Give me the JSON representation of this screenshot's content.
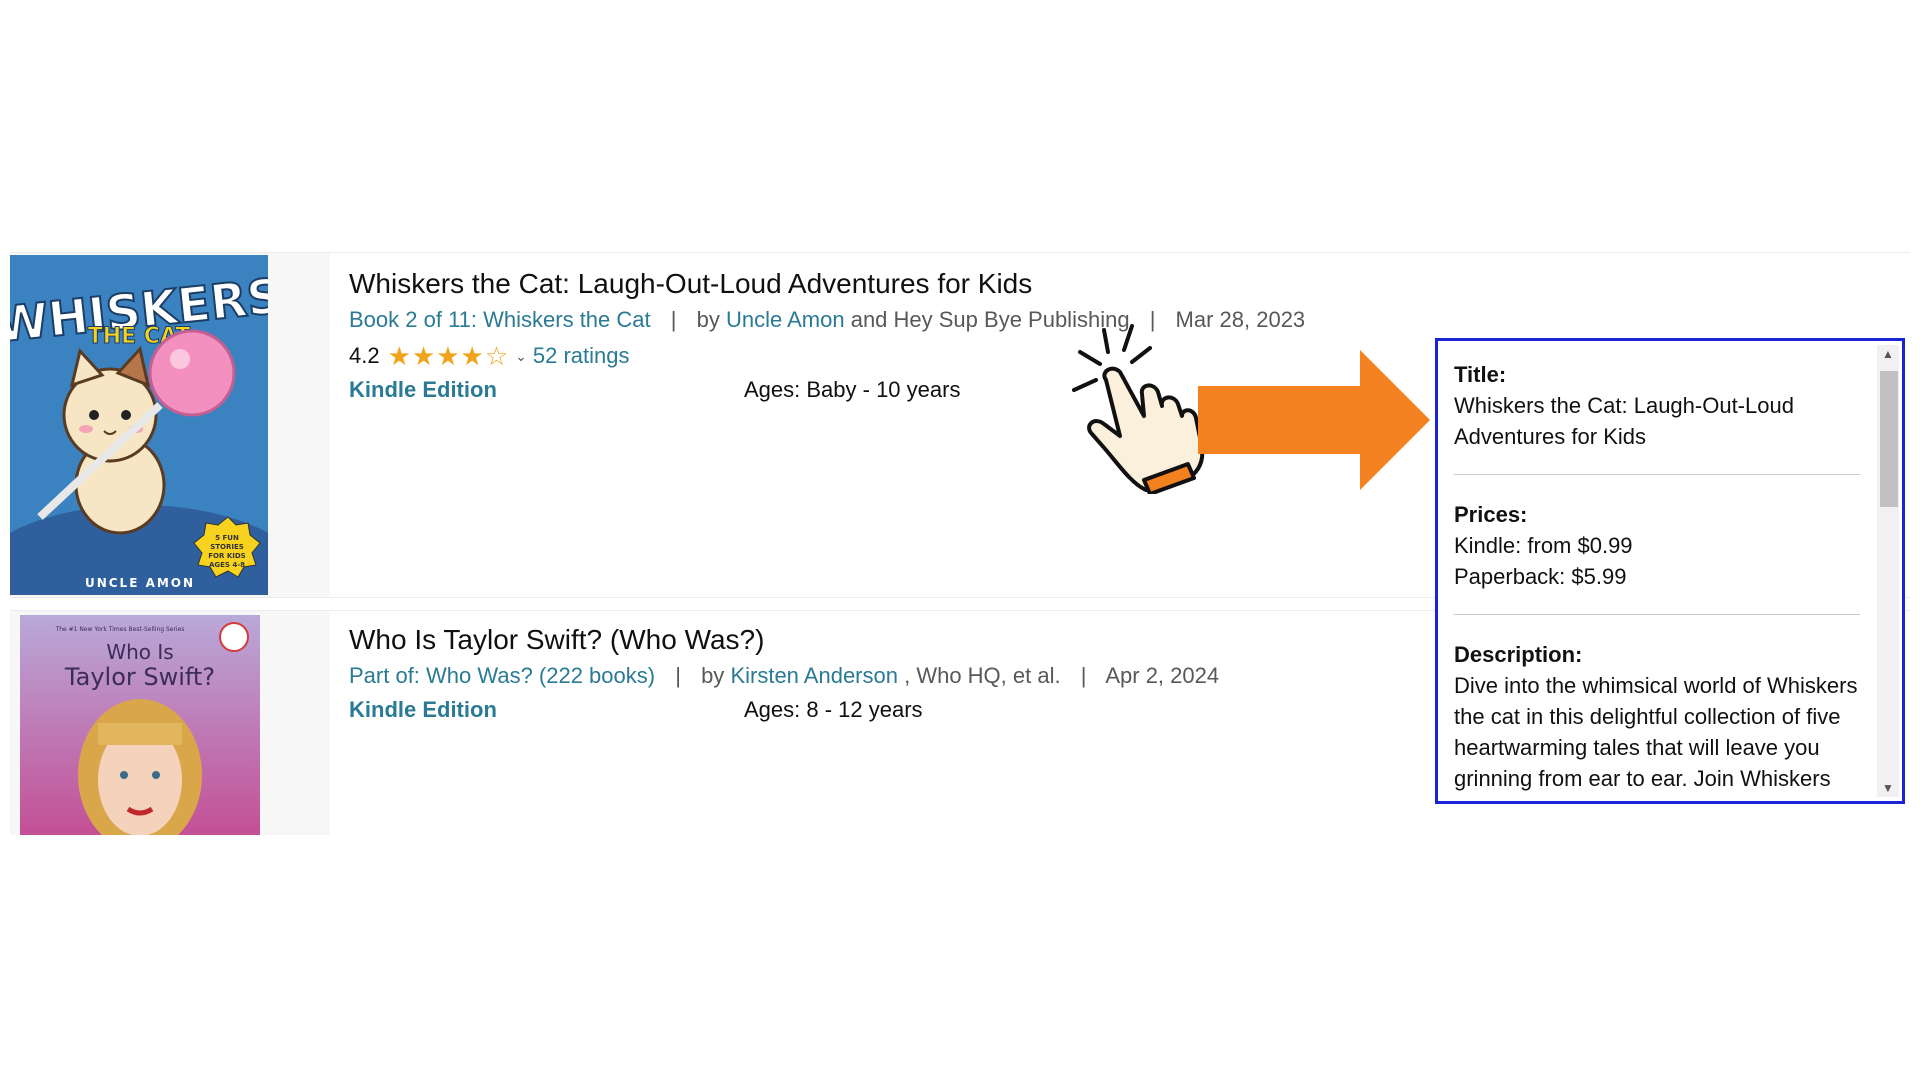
{
  "results": [
    {
      "title": "Whiskers the Cat: Laugh-Out-Loud Adventures for Kids",
      "series_link": "Book 2 of 11: Whiskers the Cat",
      "by_label": "by",
      "author_link": "Uncle Amon",
      "author_rest": " and Hey Sup Bye Publishing",
      "date": "Mar 28, 2023",
      "rating": "4.2",
      "ratings_link": "52 ratings",
      "format": "Kindle Edition",
      "ages": "Ages: Baby - 10 years",
      "cover": {
        "line1": "WHISKERS",
        "line2": "THE CAT",
        "author": "UNCLE AMON",
        "badge": "5 FUN STORIES FOR KIDS AGES 4-8"
      }
    },
    {
      "title": "Who Is Taylor Swift? (Who Was?)",
      "series_link": "Part of: Who Was? (222 books)",
      "by_label": "by",
      "author_link": "Kirsten Anderson",
      "author_rest": " , Who HQ, et al.",
      "date": "Apr 2, 2024",
      "format": "Kindle Edition",
      "ages": "Ages: 8 - 12 years",
      "cover": {
        "top": "The #1 New York Times Best-Selling Series",
        "title1": "Who Is",
        "title2": "Taylor Swift?"
      }
    }
  ],
  "separator": "|",
  "panel": {
    "title_label": "Title:",
    "title_value": "Whiskers the Cat: Laugh-Out-Loud Adventures for Kids",
    "prices_label": "Prices:",
    "kindle_price": "Kindle: from $0.99",
    "paperback_price": "Paperback: $5.99",
    "description_label": "Description:",
    "description": "Dive into the whimsical world of Whiskers the cat in this delightful collection of five heartwarming tales that will leave you grinning from ear to ear. Join Whiskers the curious and"
  },
  "colors": {
    "link": "#2a7a95",
    "star": "#f0a41b",
    "arrow": "#f4811f",
    "panel_border": "#1a23d6"
  },
  "icons": {
    "pointer": "hand-click-icon",
    "arrow": "arrow-right-icon"
  }
}
